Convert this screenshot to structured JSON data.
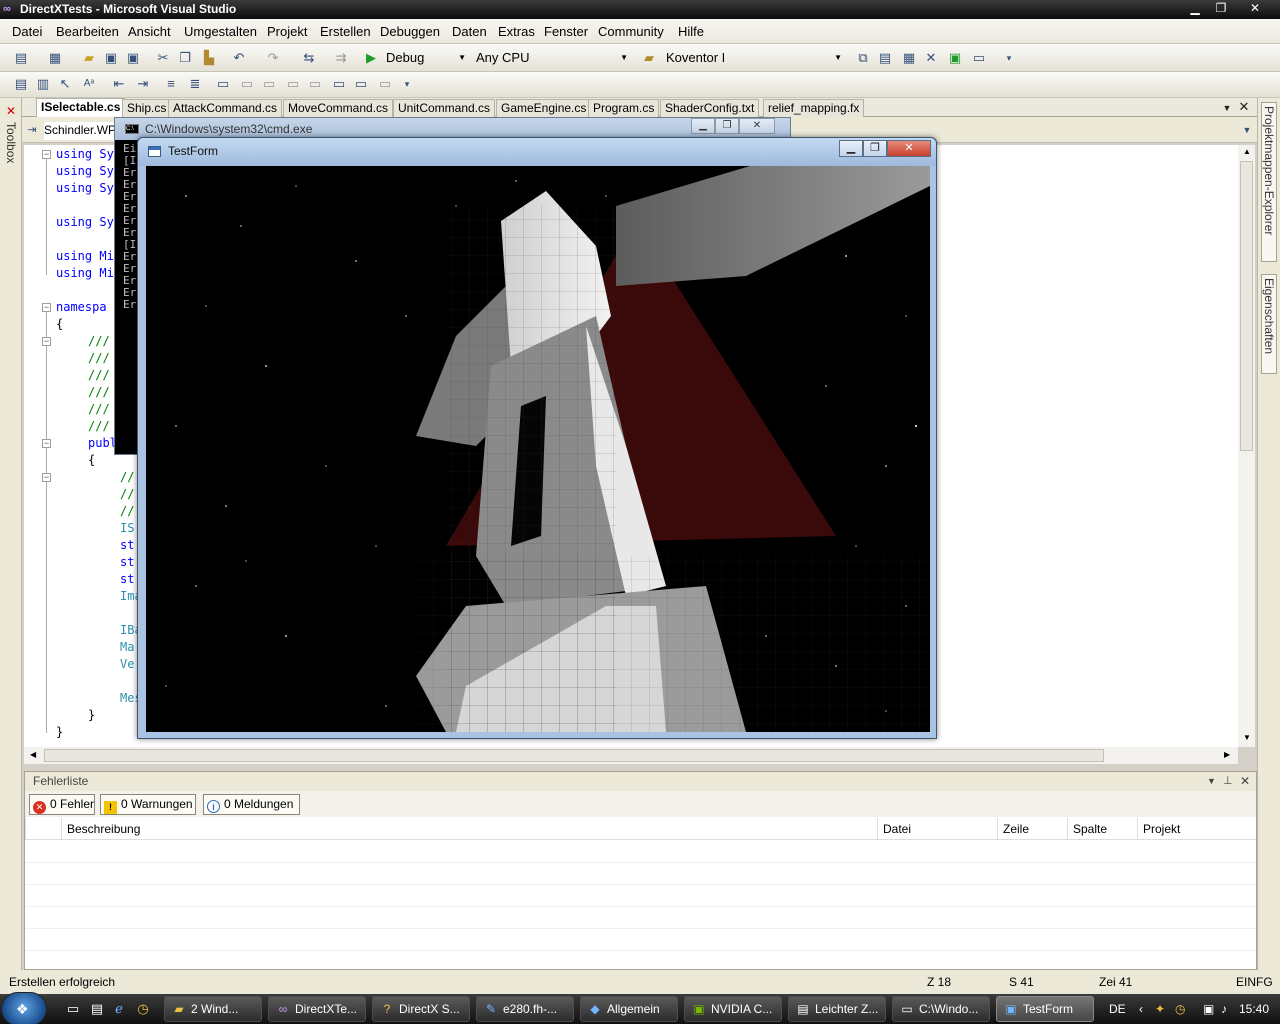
{
  "window": {
    "title": "DirectXTests - Microsoft Visual Studio"
  },
  "menu": [
    "Datei",
    "Bearbeiten",
    "Ansicht",
    "Umgestalten",
    "Projekt",
    "Erstellen",
    "Debuggen",
    "Daten",
    "Extras",
    "Fenster",
    "Community",
    "Hilfe"
  ],
  "toolbar": {
    "config": "Debug",
    "platform": "Any CPU",
    "find": "Koventor I"
  },
  "tabs": [
    "ISelectable.cs",
    "Ship.cs",
    "AttackCommand.cs",
    "MoveCommand.cs",
    "UnitCommand.cs",
    "GameEngine.cs",
    "Program.cs",
    "ShaderConfig.txt",
    "relief_mapping.fx"
  ],
  "navigation": {
    "type_combo": "Schindler.WP"
  },
  "side_panels": {
    "left": "Toolbox",
    "right1": "Projektmappen-Explorer",
    "right2": "Eigenschaften"
  },
  "code": {
    "l1": "using Sy",
    "l2": "using Sy",
    "l3": "using Sy",
    "l4": "using Sy",
    "l5": "using Mi",
    "l6": "using Mi",
    "l7": "namespa",
    "l8": "{",
    "c1": "///",
    "c2": "///",
    "c3": "///",
    "c4": "///",
    "c5": "///",
    "c6": "///",
    "l9": "publ",
    "l10": "{",
    "c7": "//",
    "c8": "//",
    "c9": "//",
    "t1": "IS",
    "l11": "st",
    "l12": "st",
    "l13": "st",
    "t2": "Ima",
    "t3": "IBa",
    "t4": "Ma",
    "t5": "Ve",
    "t6": "Mes",
    "l14": "}",
    "l15": "}"
  },
  "cmd": {
    "title": "C:\\Windows\\system32\\cmd.exe",
    "lines": "Ei\n[I\nEr\nEr\nEr\nEr\nEr\nEr\n[I\nEr\nEr\nEr\nEr\nEr"
  },
  "testform": {
    "title": "TestForm"
  },
  "errorlist": {
    "title": "Fehlerliste",
    "errors": "0 Fehler",
    "warnings": "0 Warnungen",
    "messages": "0 Meldungen",
    "columns": {
      "description": "Beschreibung",
      "file": "Datei",
      "line": "Zeile",
      "column": "Spalte",
      "project": "Projekt"
    }
  },
  "status": {
    "message": "Erstellen erfolgreich",
    "line": "Z 18",
    "col": "S 41",
    "char": "Zei 41",
    "mode": "EINFG"
  },
  "taskbar": {
    "items": [
      "2 Wind...",
      "DirectXTe...",
      "DirectX S...",
      "e280.fh-...",
      "Allgemein",
      "NVIDIA C...",
      "Leichter Z...",
      "C:\\Windo...",
      "TestForm"
    ],
    "lang": "DE",
    "clock": "15:40"
  },
  "colors": {
    "accent": "#3399ff",
    "keyword": "#0000ff",
    "comment": "#008000",
    "type": "#2b91af"
  }
}
